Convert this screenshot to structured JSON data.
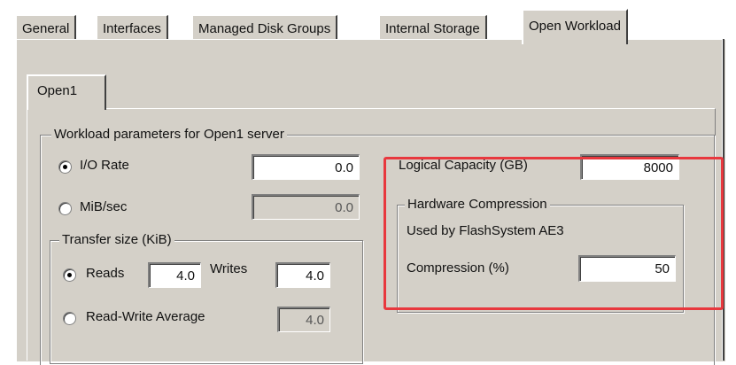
{
  "tabs": [
    {
      "label": "General"
    },
    {
      "label": "Interfaces"
    },
    {
      "label": "Managed Disk Groups"
    },
    {
      "label": "Internal Storage"
    },
    {
      "label": "Open Workload",
      "active": true
    }
  ],
  "inner_tab": {
    "label": "Open1"
  },
  "workload_group": {
    "title": "Workload parameters for Open1 server",
    "io_rate": {
      "label": "I/O Rate",
      "selected": true,
      "value": "0.0"
    },
    "mib_sec": {
      "label": "MiB/sec",
      "selected": false,
      "value": "0.0"
    },
    "transfer_size": {
      "title": "Transfer size (KiB)",
      "reads": {
        "label": "Reads",
        "selected": true,
        "value": "4.0"
      },
      "writes": {
        "label": "Writes",
        "value": "4.0"
      },
      "read_write_average": {
        "label": "Read-Write Average",
        "selected": false,
        "value": "4.0"
      }
    }
  },
  "logical_capacity": {
    "label": "Logical Capacity (GB)",
    "value": "8000"
  },
  "hardware_compression": {
    "title": "Hardware Compression",
    "used_by": "Used by FlashSystem AE3",
    "compression": {
      "label": "Compression (%)",
      "value": "50"
    }
  },
  "colors": {
    "highlight": "#e8383e",
    "dialog_bg": "#d4d0c8"
  }
}
